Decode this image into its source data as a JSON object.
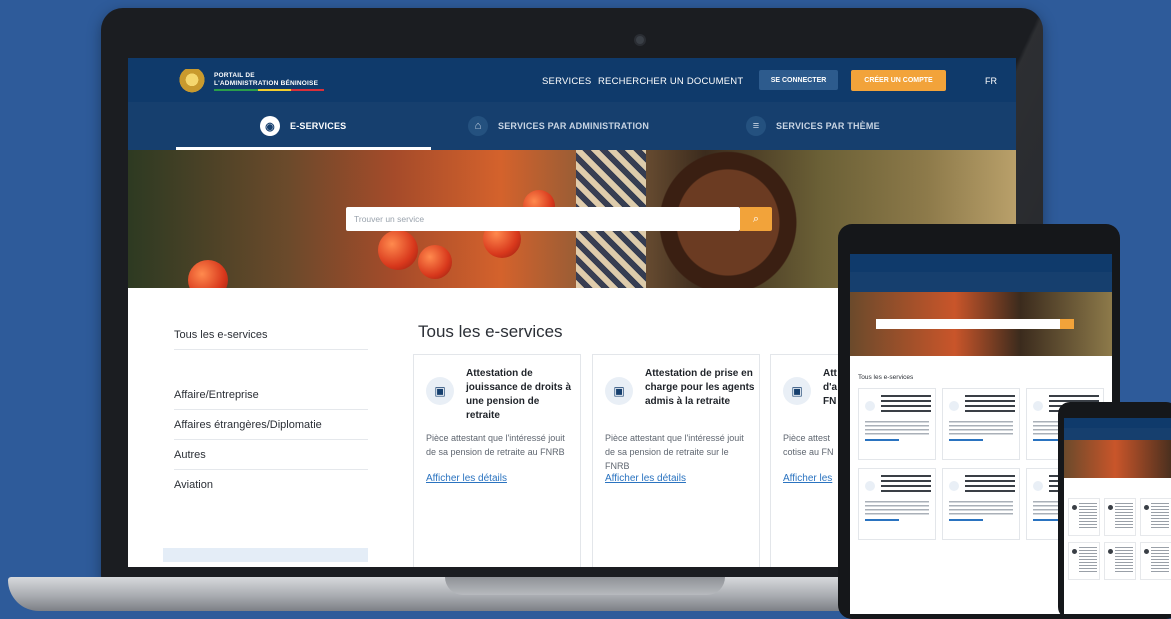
{
  "header": {
    "logo_line1": "PORTAIL DE",
    "logo_line2": "L'ADMINISTRATION BÉNINOISE",
    "nav": [
      "SERVICES",
      "RECHERCHER UN DOCUMENT"
    ],
    "login_label": "SE CONNECTER",
    "signup_label": "CRÉER UN COMPTE",
    "language": "FR"
  },
  "tabs": [
    {
      "label": "E-SERVICES",
      "icon": "globe-icon",
      "active": true
    },
    {
      "label": "SERVICES PAR ADMINISTRATION",
      "icon": "bank-icon",
      "active": false
    },
    {
      "label": "SERVICES PAR THÈME",
      "icon": "list-icon",
      "active": false
    }
  ],
  "search": {
    "placeholder": "Trouver un service",
    "button_icon": "search-icon"
  },
  "sidebar": {
    "items": [
      "Tous les e-services",
      "Affaire/Entreprise",
      "Affaires étrangères/Diplomatie",
      "Autres",
      "Aviation"
    ]
  },
  "main": {
    "title": "Tous les e-services",
    "cards": [
      {
        "title": "Attestation de jouissance de droits à une pension de retraite",
        "description": "Pièce attestant que l'intéressé jouit de sa pension de retraite au FNRB",
        "link": "Afficher les détails",
        "icon": "id-card-icon"
      },
      {
        "title": "Attestation de prise en charge pour les agents admis à la retraite",
        "description": "Pièce attestant que l'intéressé jouit de sa pension de retraite sur le FNRB",
        "link": "Afficher les détails",
        "icon": "id-card-icon"
      },
      {
        "title": "Att d'a FN",
        "description": "Pièce attest cotise au FN",
        "link": "Afficher les",
        "icon": "id-card-icon"
      }
    ]
  },
  "tablet": {
    "title": "Tous les e-services"
  },
  "colors": {
    "navy": "#0f3a6b",
    "tab_bar": "#163f6e",
    "accent_orange": "#f2a33a",
    "link_blue": "#2a73c0",
    "background": "#2e5b9a"
  }
}
